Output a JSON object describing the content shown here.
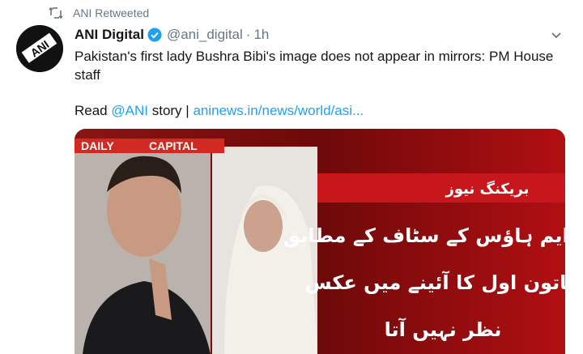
{
  "retweet": {
    "label": "ANI Retweeted"
  },
  "tweet": {
    "author_name": "ANI Digital",
    "handle": "@ani_digital",
    "separator": "·",
    "time": "1h",
    "text": "Pakistan's first lady Bushra Bibi's image does not appear in mirrors: PM House staff",
    "read_prefix": "Read",
    "mention": "@ANI",
    "read_story": "story |",
    "link": "aninews.in/news/world/asi..."
  },
  "media": {
    "logo_daily": "DAILY",
    "logo_capital": "CAPITAL",
    "breaking_label": "بریکنگ نیوز",
    "urdu_lines": [
      "پی ایم ہاؤس کے سٹاف کے مطابق",
      "خاتون اول کا آئینے میں عکس",
      "نظر نہیں آتا"
    ]
  },
  "colors": {
    "accent": "#1da1f2",
    "muted": "#657786",
    "text": "#14171a",
    "breaking_red": "#c8161d"
  },
  "icons": {
    "retweet": "retweet-icon",
    "verified": "verified-badge-icon",
    "caret": "chevron-down-icon",
    "avatar": "ani-logo-icon"
  }
}
